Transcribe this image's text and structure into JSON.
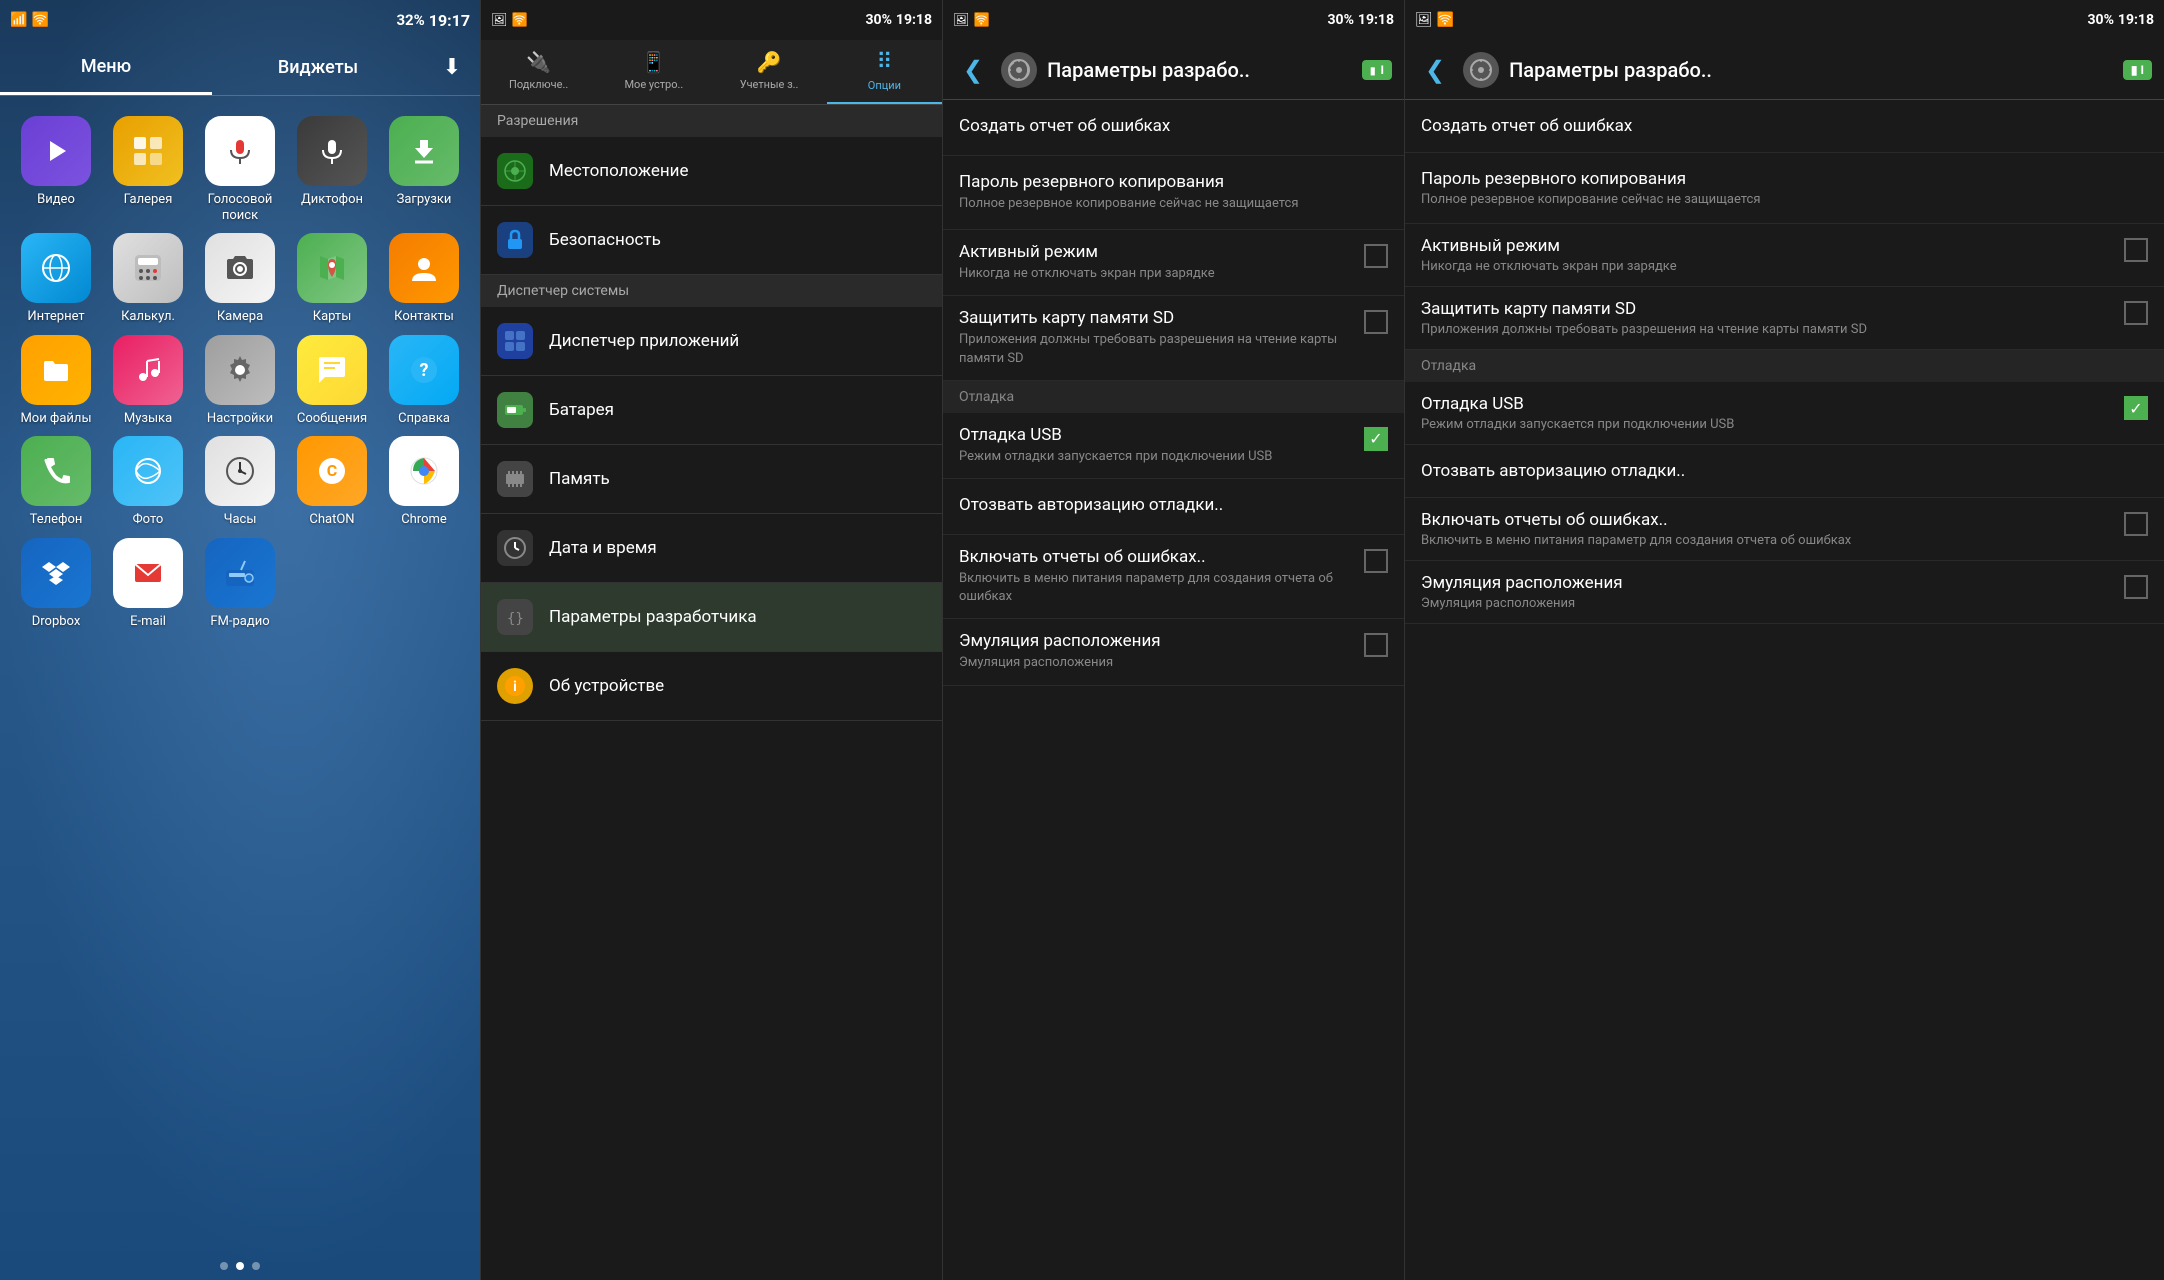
{
  "homeScreen": {
    "statusBar": {
      "signal": "▲",
      "wifi": "WiFi",
      "battery": "32%",
      "time": "19:17"
    },
    "tabs": [
      {
        "label": "Меню",
        "active": true
      },
      {
        "label": "Виджеты",
        "active": false
      }
    ],
    "downloadIcon": "⬇",
    "appRows": [
      [
        {
          "label": "Видео",
          "iconClass": "icon-video",
          "icon": "▶"
        },
        {
          "label": "Галерея",
          "iconClass": "icon-gallery",
          "icon": "🖼"
        },
        {
          "label": "Голосовой поиск",
          "iconClass": "icon-voice",
          "icon": "🎤"
        },
        {
          "label": "Диктофон",
          "iconClass": "icon-recorder",
          "icon": "🎙"
        },
        {
          "label": "Загрузки",
          "iconClass": "icon-downloads",
          "icon": "⬇"
        }
      ],
      [
        {
          "label": "Интернет",
          "iconClass": "icon-internet",
          "icon": "🌐"
        },
        {
          "label": "Калькул.",
          "iconClass": "icon-calc",
          "icon": "➕"
        },
        {
          "label": "Камера",
          "iconClass": "icon-camera",
          "icon": "📷"
        },
        {
          "label": "Карты",
          "iconClass": "icon-maps",
          "icon": "🗺"
        },
        {
          "label": "Контакты",
          "iconClass": "icon-contacts",
          "icon": "👤"
        }
      ],
      [
        {
          "label": "Мои файлы",
          "iconClass": "icon-myfiles",
          "icon": "📁"
        },
        {
          "label": "Музыка",
          "iconClass": "icon-music",
          "icon": "♪"
        },
        {
          "label": "Настройки",
          "iconClass": "icon-settings",
          "icon": "⚙"
        },
        {
          "label": "Сообщения",
          "iconClass": "icon-messages",
          "icon": "✉"
        },
        {
          "label": "Справка",
          "iconClass": "icon-help",
          "icon": "?"
        }
      ],
      [
        {
          "label": "Телефон",
          "iconClass": "icon-phone",
          "icon": "📞"
        },
        {
          "label": "Фото",
          "iconClass": "icon-photos",
          "icon": "📸"
        },
        {
          "label": "Часы",
          "iconClass": "icon-clock",
          "icon": "🕐"
        },
        {
          "label": "ChatON",
          "iconClass": "icon-chaton",
          "icon": "C"
        },
        {
          "label": "Chrome",
          "iconClass": "icon-chrome",
          "icon": "◎"
        }
      ],
      [
        {
          "label": "Dropbox",
          "iconClass": "icon-dropbox",
          "icon": "📦"
        },
        {
          "label": "E-mail",
          "iconClass": "icon-email",
          "icon": "✉"
        },
        {
          "label": "FM-радио",
          "iconClass": "icon-fmradio",
          "icon": "📻"
        },
        {
          "label": "",
          "iconClass": "",
          "icon": ""
        },
        {
          "label": "",
          "iconClass": "",
          "icon": ""
        }
      ]
    ],
    "dots": [
      false,
      true,
      false
    ]
  },
  "settingsPanel": {
    "statusBar": {
      "battery": "30%",
      "time": "19:18"
    },
    "tabs": [
      {
        "label": "Подключе..",
        "icon": "🔌",
        "active": false
      },
      {
        "label": "Мое устро..",
        "icon": "📱",
        "active": false
      },
      {
        "label": "Учетные з..",
        "icon": "🔑",
        "active": false
      },
      {
        "label": "Опции",
        "icon": "⠿",
        "active": true
      }
    ],
    "sectionHeader": "Разрешения",
    "items": [
      {
        "icon": "📍",
        "iconBg": "#1a6b1a",
        "text": "Местоположение"
      },
      {
        "icon": "🔒",
        "iconBg": "#1a4080",
        "text": "Безопасность"
      }
    ],
    "sectionHeader2": "Диспетчер системы",
    "items2": [
      {
        "icon": "⊞",
        "iconBg": "#2040a0",
        "text": "Диспетчер приложений"
      },
      {
        "icon": "🔋",
        "iconBg": "#408040",
        "text": "Батарея"
      },
      {
        "icon": "💾",
        "iconBg": "#555",
        "text": "Память"
      },
      {
        "icon": "🕐",
        "iconBg": "#444",
        "text": "Дата и время"
      },
      {
        "icon": "{}",
        "iconBg": "#555",
        "text": "Параметры разработчика"
      },
      {
        "icon": "ℹ",
        "iconBg": "#e0a000",
        "text": "Об устройстве"
      }
    ]
  },
  "devPanel": {
    "statusBar": {
      "battery": "30%",
      "time": "19:18"
    },
    "titleBar": {
      "backLabel": "❮",
      "icon": "⚙",
      "title": "Параметры разрабо..",
      "batteryBadge": "I"
    },
    "options": [
      {
        "type": "simple",
        "title": "Создать отчет об ошибках",
        "subtitle": ""
      },
      {
        "type": "row",
        "title": "Пароль резервного копирования",
        "subtitle": "Полное резервное копирование сейчас не защищается",
        "checked": false,
        "hasCheckbox": false
      },
      {
        "type": "row",
        "title": "Активный режим",
        "subtitle": "Никогда не отключать экран при зарядке",
        "checked": false,
        "hasCheckbox": true
      },
      {
        "type": "row",
        "title": "Защитить карту памяти SD",
        "subtitle": "Приложения должны требовать разрешения на чтение карты памяти SD",
        "checked": false,
        "hasCheckbox": true
      }
    ],
    "sectionOtladka": "Отладка",
    "otladkaOptions": [
      {
        "type": "row",
        "title": "Отладка USB",
        "subtitle": "Режим отладки запускается при подключении USB",
        "checked": true,
        "hasCheckbox": true
      },
      {
        "type": "simple",
        "title": "Отозвать авторизацию отладки..",
        "subtitle": ""
      },
      {
        "type": "row",
        "title": "Включать отчеты об ошибках..",
        "subtitle": "Включить в меню питания параметр для создания отчета об ошибках",
        "checked": false,
        "hasCheckbox": true
      },
      {
        "type": "row",
        "title": "Эмуляция расположения",
        "subtitle": "Эмуляция расположения",
        "checked": false,
        "hasCheckbox": true
      }
    ]
  }
}
